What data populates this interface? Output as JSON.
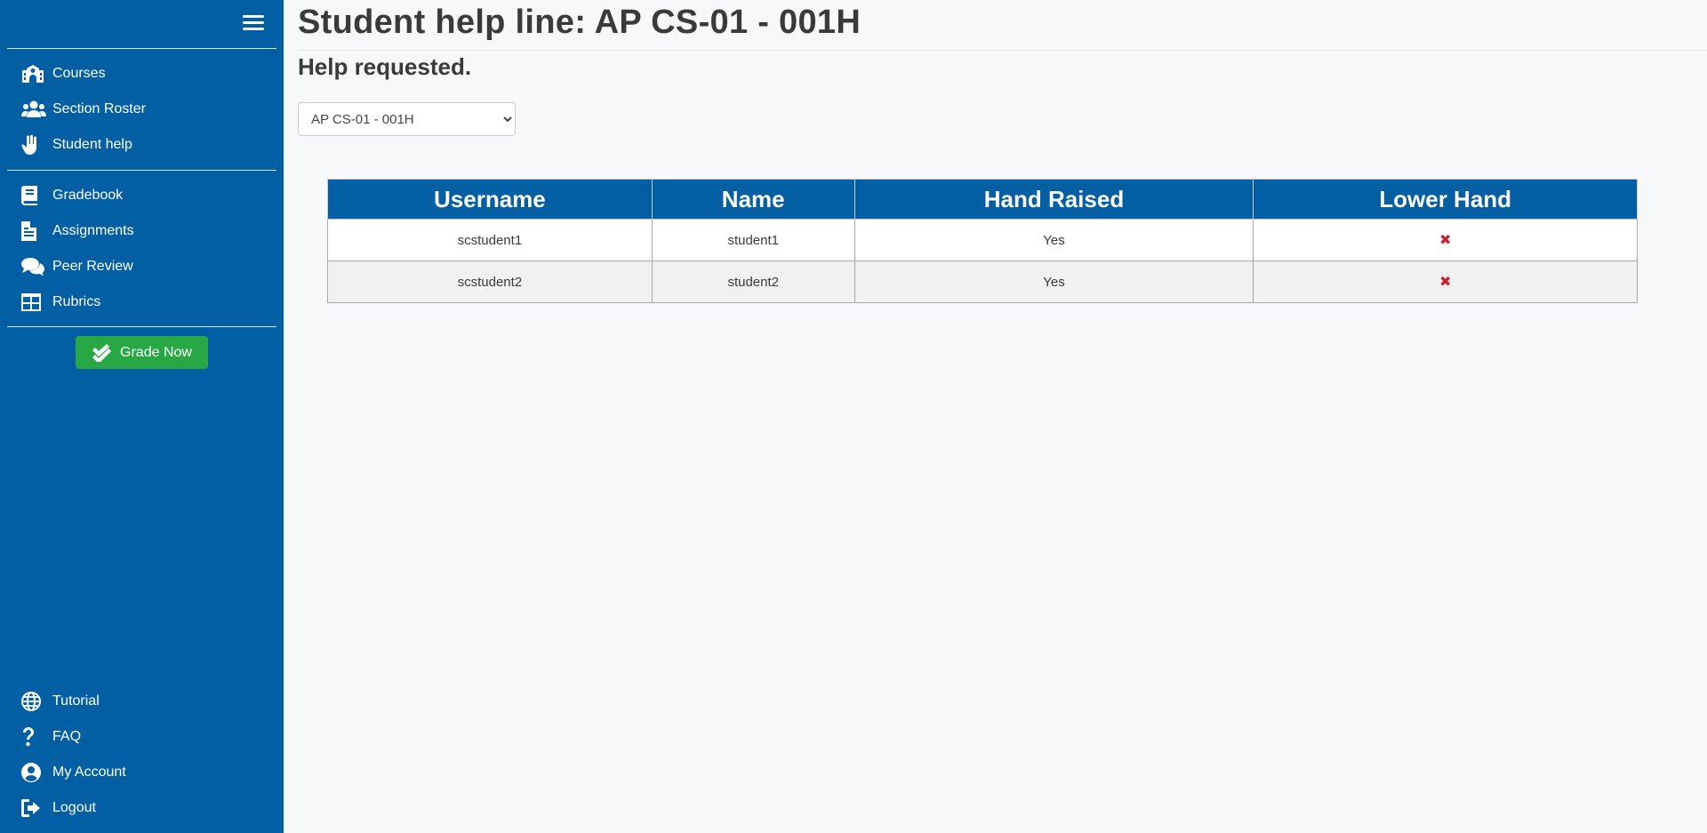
{
  "sidebar": {
    "primary_items": [
      {
        "label": "Courses",
        "icon": "school-icon"
      },
      {
        "label": "Section Roster",
        "icon": "users-icon"
      },
      {
        "label": "Student help",
        "icon": "raised-hand-icon"
      }
    ],
    "secondary_items": [
      {
        "label": "Gradebook",
        "icon": "book-icon"
      },
      {
        "label": "Assignments",
        "icon": "document-icon"
      },
      {
        "label": "Peer Review",
        "icon": "comments-icon"
      },
      {
        "label": "Rubrics",
        "icon": "grid-icon"
      }
    ],
    "grade_now_label": "Grade Now",
    "footer_items": [
      {
        "label": "Tutorial",
        "icon": "globe-icon"
      },
      {
        "label": "FAQ",
        "icon": "question-icon"
      },
      {
        "label": "My Account",
        "icon": "user-circle-icon"
      },
      {
        "label": "Logout",
        "icon": "sign-out-icon"
      }
    ]
  },
  "main": {
    "title": "Student help line: AP CS-01 - 001H",
    "subtitle": "Help requested.",
    "section_select": {
      "selected": "AP CS-01 - 001H"
    },
    "table": {
      "headers": [
        "Username",
        "Name",
        "Hand Raised",
        "Lower Hand"
      ],
      "rows": [
        {
          "username": "scstudent1",
          "name": "student1",
          "hand_raised": "Yes",
          "lower_hand": "✖"
        },
        {
          "username": "scstudent2",
          "name": "student2",
          "hand_raised": "Yes",
          "lower_hand": "✖"
        }
      ]
    }
  },
  "colors": {
    "sidebar": "#035fa3",
    "table_header": "#035fa3",
    "grade_now": "#28a745",
    "lower_hand_icon": "#c8232c",
    "background": "#f7f8fa"
  }
}
